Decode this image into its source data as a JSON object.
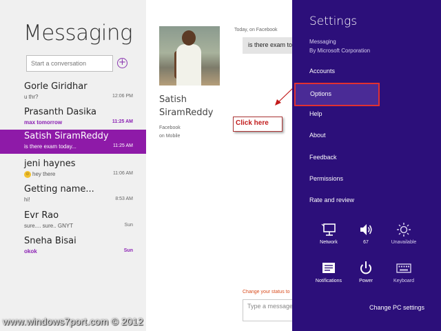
{
  "app": {
    "title": "Messaging"
  },
  "search": {
    "placeholder": "Start a conversation"
  },
  "new_conversation_symbol": "+",
  "conversations": [
    {
      "name": "Gorle Giridhar",
      "preview": "u thr?",
      "time": "12:06 PM",
      "unread": false,
      "selected": false
    },
    {
      "name": "Prasanth Dasika",
      "preview": "max tomorrow",
      "time": "11:25 AM",
      "unread": true,
      "selected": false
    },
    {
      "name": "Satish SiramReddy",
      "preview": "is there exam today...",
      "time": "11:25 AM",
      "unread": false,
      "selected": true
    },
    {
      "name": "jeni haynes",
      "preview": "hey there",
      "time": "11:06 AM",
      "unread": false,
      "selected": false,
      "icon": "smiley-icon"
    },
    {
      "name": "Getting name...",
      "preview": "hi!",
      "time": "8:53 AM",
      "unread": false,
      "selected": false
    },
    {
      "name": "Evr Rao",
      "preview": "sure.... sure.. GNYT",
      "time": "Sun",
      "unread": false,
      "selected": false
    },
    {
      "name": "Sneha Bisai",
      "preview": "okok",
      "time": "Sun",
      "unread": true,
      "selected": false
    }
  ],
  "contact": {
    "first_name": "Satish",
    "last_name": "SiramReddy",
    "source_line1": "Facebook",
    "source_line2": "on Mobile"
  },
  "thread": {
    "date_label": "Today, on Facebook",
    "message": "is there exam today...",
    "status_link": "Change your status to",
    "input_placeholder": "Type a message"
  },
  "annotation": {
    "text": "Click here",
    "color": "#c21b1b"
  },
  "watermark": "www.windows7port.com © 2012",
  "settings": {
    "title": "Settings",
    "app_name": "Messaging",
    "publisher": "By Microsoft Corporation",
    "items": [
      "Accounts",
      "Options",
      "Help",
      "About",
      "Feedback",
      "Permissions",
      "Rate and review"
    ],
    "highlighted_item": "Options",
    "quick_settings": [
      {
        "label": "Network",
        "icon": "network-icon"
      },
      {
        "label": "67",
        "icon": "volume-icon"
      },
      {
        "label": "Unavailable",
        "icon": "brightness-icon"
      },
      {
        "label": "Notifications",
        "icon": "notifications-icon"
      },
      {
        "label": "Power",
        "icon": "power-icon"
      },
      {
        "label": "Keyboard",
        "icon": "keyboard-icon"
      }
    ],
    "change_pc_settings": "Change PC settings"
  },
  "colors": {
    "accent": "#8e1aa8",
    "unread_text": "#8a1fb3",
    "charm_background": "#2c0f7a",
    "highlight_border": "#e23131"
  }
}
